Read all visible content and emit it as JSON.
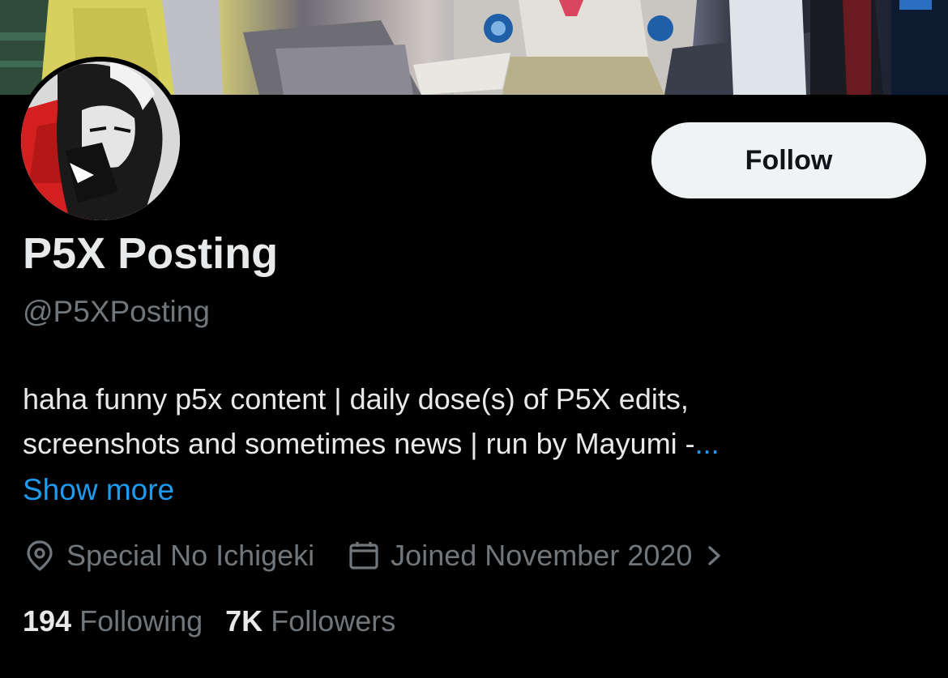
{
  "profile": {
    "display_name": "P5X Posting",
    "handle": "@P5XPosting",
    "bio_line1": "haha funny p5x content | daily dose(s) of P5X edits,",
    "bio_line2": "screenshots and sometimes news | run by Mayumi -",
    "bio_ellipsis": "...",
    "show_more": "Show more",
    "location": "Special No Ichigeki",
    "joined": "Joined November 2020"
  },
  "actions": {
    "follow_label": "Follow"
  },
  "stats": {
    "following_count": "194",
    "following_label": "Following",
    "followers_count": "7K",
    "followers_label": "Followers"
  },
  "icons": {
    "location": "location-pin-icon",
    "calendar": "calendar-icon",
    "chevron": "chevron-right-icon"
  },
  "colors": {
    "background": "#000000",
    "text_primary": "#e7e9ea",
    "text_secondary": "#71767b",
    "link": "#1d9bf0",
    "follow_button_bg": "#eff3f4",
    "follow_button_text": "#0f1419"
  }
}
